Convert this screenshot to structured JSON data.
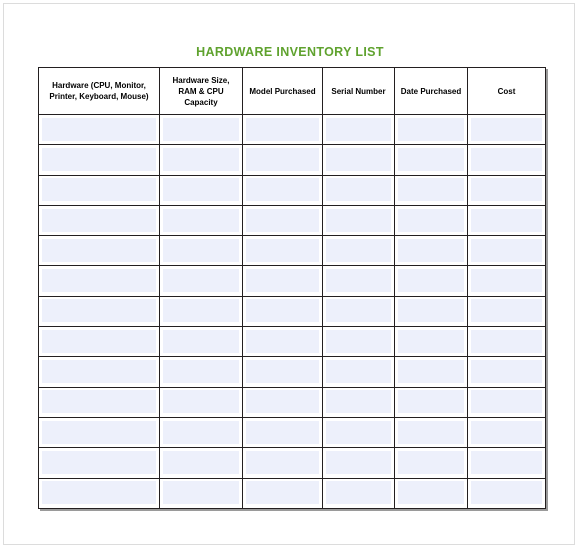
{
  "document": {
    "title": "HARDWARE INVENTORY LIST",
    "title_color": "#5fa22e"
  },
  "table": {
    "columns": [
      {
        "key": "hardware",
        "label": "Hardware (CPU, Monitor, Printer, Keyboard, Mouse)"
      },
      {
        "key": "size",
        "label": "Hardware Size, RAM & CPU Capacity"
      },
      {
        "key": "model",
        "label": "Model Purchased"
      },
      {
        "key": "serial",
        "label": "Serial Number"
      },
      {
        "key": "date",
        "label": "Date Purchased"
      },
      {
        "key": "cost",
        "label": "Cost"
      }
    ],
    "row_count": 13,
    "rows": [
      {
        "hardware": "",
        "size": "",
        "model": "",
        "serial": "",
        "date": "",
        "cost": ""
      },
      {
        "hardware": "",
        "size": "",
        "model": "",
        "serial": "",
        "date": "",
        "cost": ""
      },
      {
        "hardware": "",
        "size": "",
        "model": "",
        "serial": "",
        "date": "",
        "cost": ""
      },
      {
        "hardware": "",
        "size": "",
        "model": "",
        "serial": "",
        "date": "",
        "cost": ""
      },
      {
        "hardware": "",
        "size": "",
        "model": "",
        "serial": "",
        "date": "",
        "cost": ""
      },
      {
        "hardware": "",
        "size": "",
        "model": "",
        "serial": "",
        "date": "",
        "cost": ""
      },
      {
        "hardware": "",
        "size": "",
        "model": "",
        "serial": "",
        "date": "",
        "cost": ""
      },
      {
        "hardware": "",
        "size": "",
        "model": "",
        "serial": "",
        "date": "",
        "cost": ""
      },
      {
        "hardware": "",
        "size": "",
        "model": "",
        "serial": "",
        "date": "",
        "cost": ""
      },
      {
        "hardware": "",
        "size": "",
        "model": "",
        "serial": "",
        "date": "",
        "cost": ""
      },
      {
        "hardware": "",
        "size": "",
        "model": "",
        "serial": "",
        "date": "",
        "cost": ""
      },
      {
        "hardware": "",
        "size": "",
        "model": "",
        "serial": "",
        "date": "",
        "cost": ""
      },
      {
        "hardware": "",
        "size": "",
        "model": "",
        "serial": "",
        "date": "",
        "cost": ""
      }
    ],
    "cell_fill_color": "#edf0fb",
    "border_color": "#231f20"
  }
}
